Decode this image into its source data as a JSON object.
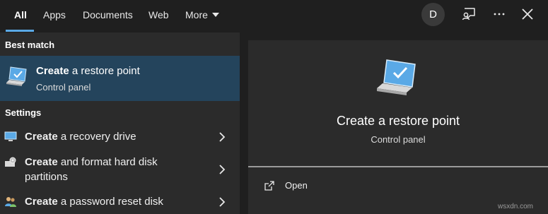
{
  "topbar": {
    "tabs": [
      {
        "label": "All",
        "active": true
      },
      {
        "label": "Apps"
      },
      {
        "label": "Documents"
      },
      {
        "label": "Web"
      },
      {
        "label": "More"
      }
    ],
    "avatar_initial": "D",
    "icons": [
      "feedback-icon",
      "more-options-icon",
      "close-icon"
    ]
  },
  "left": {
    "best_match_label": "Best match",
    "best_match": {
      "title_bold": "Create",
      "title_rest": " a restore point",
      "subtitle": "Control panel",
      "icon": "computer-check-icon"
    },
    "settings_label": "Settings",
    "settings": [
      {
        "bold": "Create",
        "rest": " a recovery drive",
        "icon": "recovery-drive-icon"
      },
      {
        "bold": "Create",
        "rest": " and format hard disk",
        "line2": "partitions",
        "icon": "disk-management-icon"
      },
      {
        "bold": "Create",
        "rest": " a password reset disk",
        "icon": "users-icon"
      }
    ]
  },
  "right": {
    "title": "Create a restore point",
    "subtitle": "Control panel",
    "actions": [
      {
        "label": "Open",
        "icon": "open-icon"
      }
    ]
  },
  "watermark": "wsxdn.com",
  "colors": {
    "accent": "#5aa9e6",
    "selected": "#24445c",
    "pane": "#2b2b2b",
    "background": "#1f1f1f"
  }
}
